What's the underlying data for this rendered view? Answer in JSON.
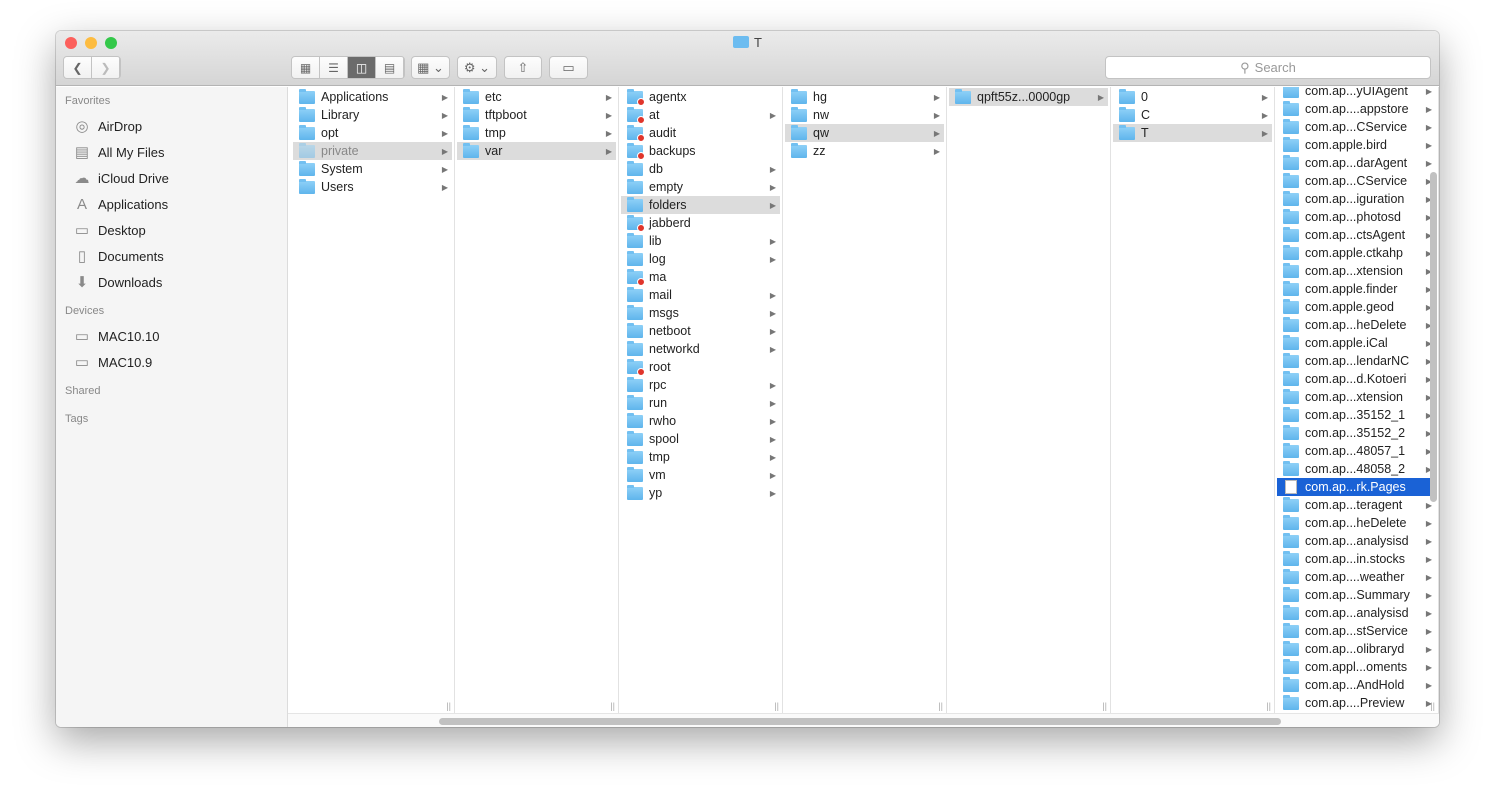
{
  "window": {
    "title": "T",
    "folder_icon": "folder-icon"
  },
  "toolbar": {
    "views": [
      "icon-view",
      "list-view",
      "column-view",
      "cover-flow-view"
    ],
    "active_view": "column-view",
    "arrange": "arrange-icon",
    "action": "gear-icon",
    "share": "share-icon",
    "tags": "tag-icon",
    "search_placeholder": "Search"
  },
  "sidebar": {
    "sections": [
      {
        "label": "Favorites",
        "items": [
          {
            "label": "AirDrop",
            "icon": "airdrop-icon"
          },
          {
            "label": "All My Files",
            "icon": "all-files-icon"
          },
          {
            "label": "iCloud Drive",
            "icon": "cloud-icon"
          },
          {
            "label": "Applications",
            "icon": "applications-icon"
          },
          {
            "label": "Desktop",
            "icon": "desktop-icon"
          },
          {
            "label": "Documents",
            "icon": "documents-icon"
          },
          {
            "label": "Downloads",
            "icon": "downloads-icon"
          }
        ]
      },
      {
        "label": "Devices",
        "items": [
          {
            "label": "MAC10.10",
            "icon": "disk-icon"
          },
          {
            "label": "MAC10.9",
            "icon": "disk-icon"
          }
        ]
      },
      {
        "label": "Shared",
        "items": []
      },
      {
        "label": "Tags",
        "items": []
      }
    ]
  },
  "columns": [
    {
      "items": [
        {
          "n": "Applications"
        },
        {
          "n": "Library"
        },
        {
          "n": "opt"
        },
        {
          "n": "private",
          "s": "sel",
          "dim": true
        },
        {
          "n": "System"
        },
        {
          "n": "Users"
        }
      ]
    },
    {
      "items": [
        {
          "n": "etc"
        },
        {
          "n": "tftpboot"
        },
        {
          "n": "tmp"
        },
        {
          "n": "var",
          "s": "sel"
        }
      ]
    },
    {
      "items": [
        {
          "n": "agentx",
          "b": 1,
          "na": 1
        },
        {
          "n": "at",
          "b": 1
        },
        {
          "n": "audit",
          "b": 1,
          "na": 1
        },
        {
          "n": "backups",
          "b": 1,
          "na": 1
        },
        {
          "n": "db"
        },
        {
          "n": "empty"
        },
        {
          "n": "folders",
          "s": "sel"
        },
        {
          "n": "jabberd",
          "b": 1,
          "na": 1
        },
        {
          "n": "lib"
        },
        {
          "n": "log"
        },
        {
          "n": "ma",
          "b": 1,
          "na": 1
        },
        {
          "n": "mail"
        },
        {
          "n": "msgs"
        },
        {
          "n": "netboot"
        },
        {
          "n": "networkd"
        },
        {
          "n": "root",
          "b": 1,
          "na": 1
        },
        {
          "n": "rpc"
        },
        {
          "n": "run"
        },
        {
          "n": "rwho"
        },
        {
          "n": "spool"
        },
        {
          "n": "tmp"
        },
        {
          "n": "vm"
        },
        {
          "n": "yp"
        }
      ]
    },
    {
      "items": [
        {
          "n": "hg"
        },
        {
          "n": "nw"
        },
        {
          "n": "qw",
          "s": "sel"
        },
        {
          "n": "zz"
        }
      ]
    },
    {
      "items": [
        {
          "n": "qpft55z...0000gp",
          "s": "sel"
        }
      ]
    },
    {
      "items": [
        {
          "n": "0"
        },
        {
          "n": "C"
        },
        {
          "n": "T",
          "s": "sel"
        }
      ]
    },
    {
      "scrolled": true,
      "items": [
        {
          "n": "com.ap...yUIAgent"
        },
        {
          "n": "com.ap....appstore"
        },
        {
          "n": "com.ap...CService"
        },
        {
          "n": "com.apple.bird"
        },
        {
          "n": "com.ap...darAgent"
        },
        {
          "n": "com.ap...CService"
        },
        {
          "n": "com.ap...iguration"
        },
        {
          "n": "com.ap...photosd"
        },
        {
          "n": "com.ap...ctsAgent"
        },
        {
          "n": "com.apple.ctkahp"
        },
        {
          "n": "com.ap...xtension"
        },
        {
          "n": "com.apple.finder"
        },
        {
          "n": "com.apple.geod"
        },
        {
          "n": "com.ap...heDelete"
        },
        {
          "n": "com.apple.iCal"
        },
        {
          "n": "com.ap...lendarNC"
        },
        {
          "n": "com.ap...d.Kotoeri"
        },
        {
          "n": "com.ap...xtension"
        },
        {
          "n": "com.ap...35152_1"
        },
        {
          "n": "com.ap...35152_2"
        },
        {
          "n": "com.ap...48057_1"
        },
        {
          "n": "com.ap...48058_2"
        },
        {
          "n": "com.ap...rk.Pages",
          "s": "act",
          "file": 1,
          "na": 1
        },
        {
          "n": "com.ap...teragent"
        },
        {
          "n": "com.ap...heDelete"
        },
        {
          "n": "com.ap...analysisd"
        },
        {
          "n": "com.ap...in.stocks"
        },
        {
          "n": "com.ap....weather"
        },
        {
          "n": "com.ap...Summary"
        },
        {
          "n": "com.ap...analysisd"
        },
        {
          "n": "com.ap...stService"
        },
        {
          "n": "com.ap...olibraryd"
        },
        {
          "n": "com.appl...oments"
        },
        {
          "n": "com.ap...AndHold"
        },
        {
          "n": "com.ap....Preview"
        }
      ]
    }
  ],
  "colors": {
    "selection": "#1a62d6",
    "inactive_selection": "#dcdcdc",
    "folder": "#6cbcf0",
    "badge": "#e0352b"
  }
}
